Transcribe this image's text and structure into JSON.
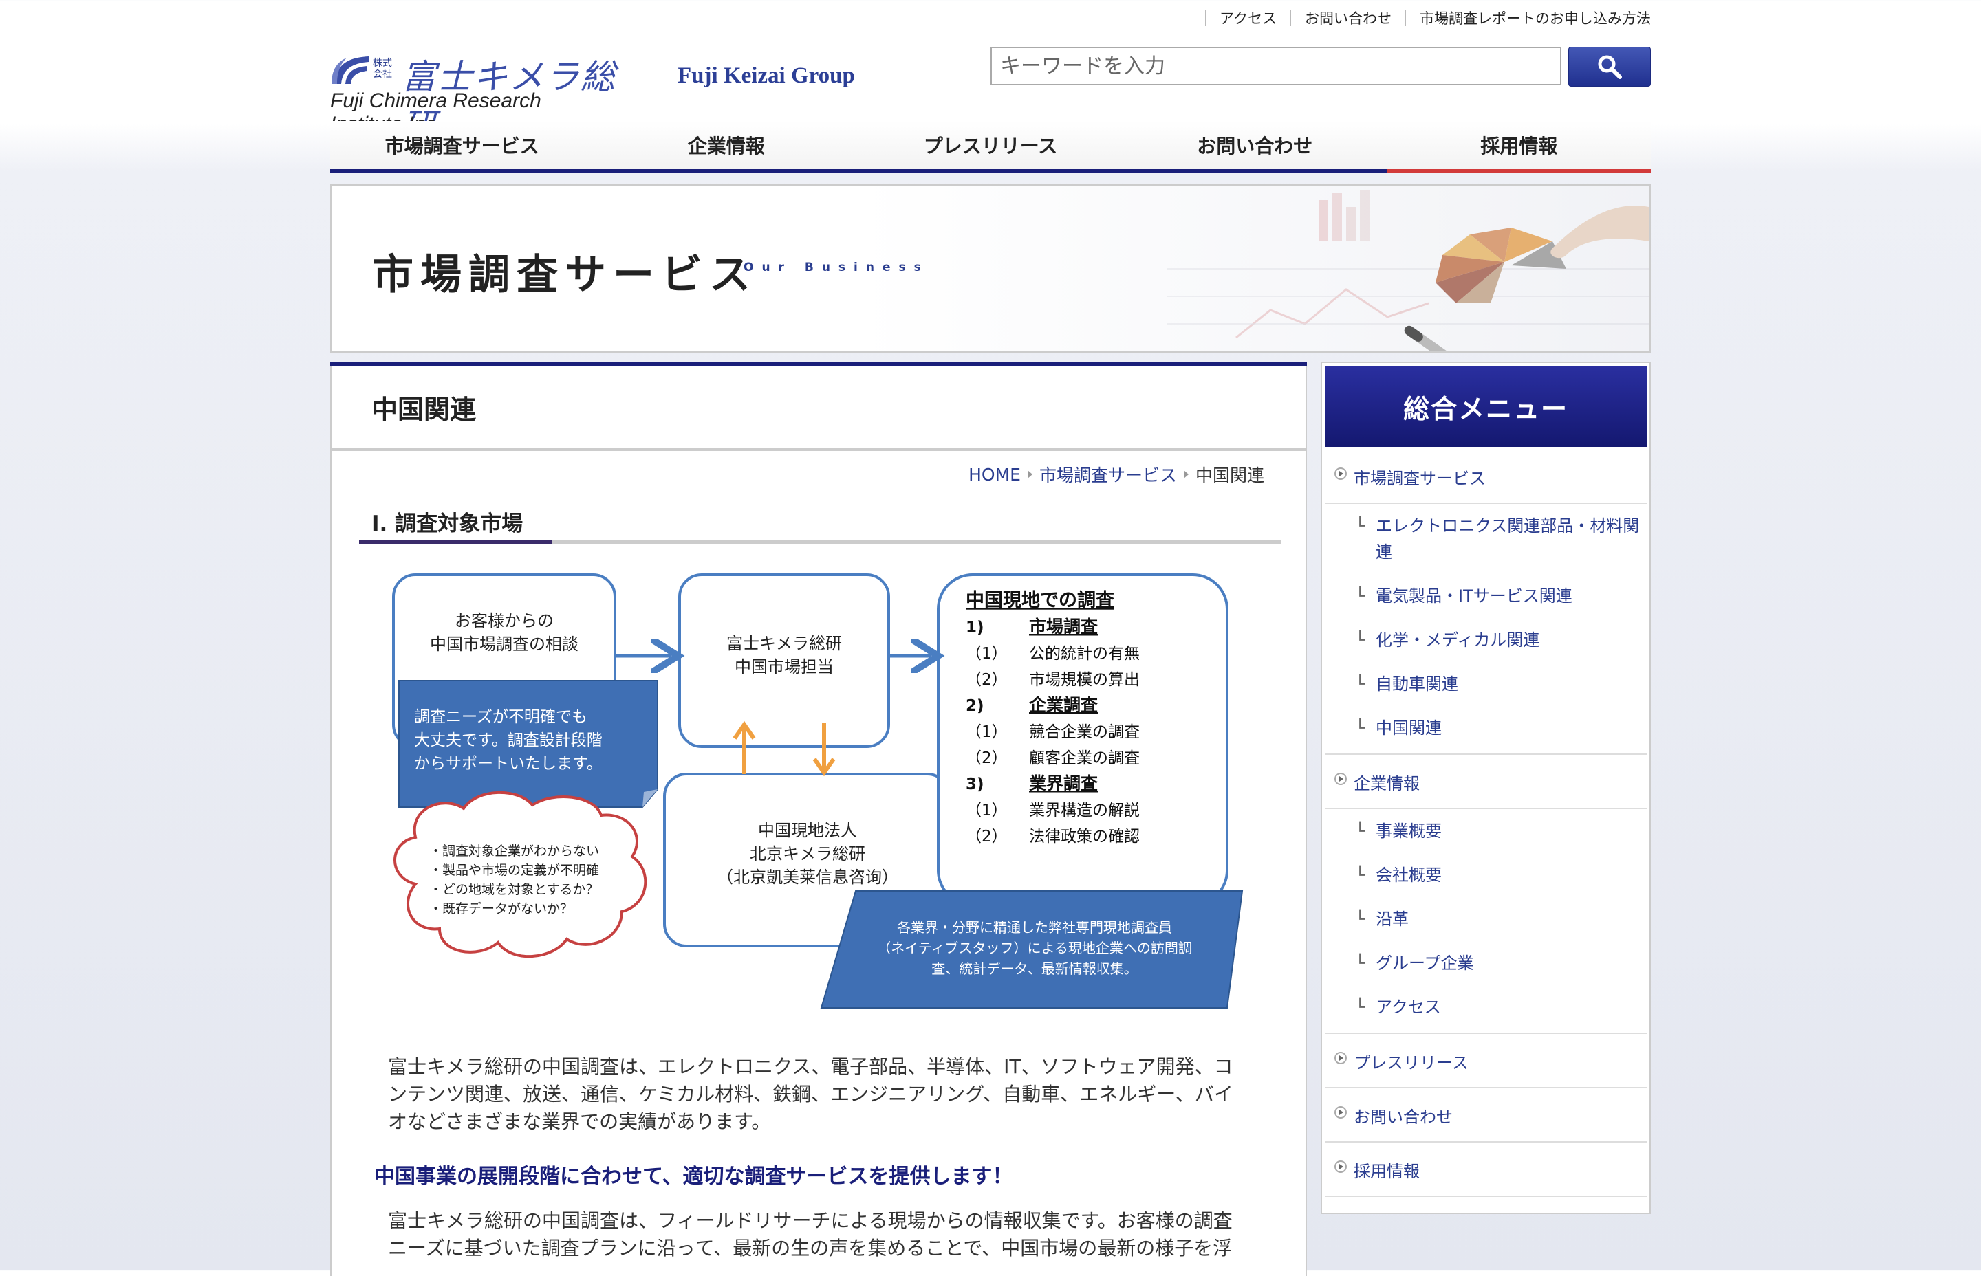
{
  "header": {
    "util_links": [
      "アクセス",
      "お問い合わせ",
      "市場調査レポートのお申し込み方法"
    ],
    "logo": {
      "jp_small_1": "株式",
      "jp_small_2": "会社",
      "jp": "富士キメラ総研",
      "en": "Fuji Chimera Research Institute,Inc"
    },
    "group_name": "Fuji Keizai Group",
    "search": {
      "placeholder": "キーワードを入力",
      "button_icon": "search-icon"
    }
  },
  "nav": {
    "items": [
      "市場調査サービス",
      "企業情報",
      "プレスリリース",
      "お問い合わせ",
      "採用情報"
    ],
    "accent_color": "#1a1f7a",
    "recruit_color": "#d23a3a"
  },
  "banner": {
    "title": "市場調査サービス",
    "subtitle": "Our Business"
  },
  "main": {
    "title": "中国関連",
    "breadcrumb": [
      "HOME",
      "市場調査サービス",
      "中国関連"
    ],
    "section_title": "I.  調査対象市場",
    "diagram": {
      "box1": [
        "お客様からの",
        "中国市場調査の相談"
      ],
      "note1": [
        "調査ニーズが不明確でも",
        "大丈夫です。調査設計段階",
        "からサポートいたします。"
      ],
      "cloud": [
        "・調査対象企業がわからない",
        "・製品や市場の定義が不明確",
        "・どの地域を対象とするか？",
        "・既存データがないか？"
      ],
      "box2": [
        "富士キメラ総研",
        "中国市場担当"
      ],
      "box3": [
        "中国現地法人",
        "北京キメラ総研",
        "（北京凱美莱信息咨询）"
      ],
      "box4_title": "中国現地での調査",
      "box4_lines": [
        {
          "num": "1)",
          "text": "市場調査",
          "bold": true
        },
        {
          "num": "（1）",
          "text": "公的統計の有無",
          "bold": false
        },
        {
          "num": "（2）",
          "text": "市場規模の算出",
          "bold": false
        },
        {
          "num": "2)",
          "text": "企業調査",
          "bold": true
        },
        {
          "num": "（1）",
          "text": "競合企業の調査",
          "bold": false
        },
        {
          "num": "（2）",
          "text": "顧客企業の調査",
          "bold": false
        },
        {
          "num": "3)",
          "text": "業界調査",
          "bold": true
        },
        {
          "num": "（1）",
          "text": "業界構造の解説",
          "bold": false
        },
        {
          "num": "（2）",
          "text": "法律政策の確認",
          "bold": false
        }
      ],
      "note2": [
        "各業界・分野に精通した弊社専門現地調査員",
        "（ネイティブスタッフ）による現地企業への訪問調",
        "査、統計データ、最新情報収集。"
      ]
    },
    "para1": [
      "富士キメラ総研の中国調査は、エレクトロニクス、電子部品、半導体、IT、ソフトウェア開発、コ",
      "ンテンツ関連、放送、通信、ケミカル材料、鉄鋼、エンジニアリング、自動車、エネルギー、バイ",
      "オなどさまざまな業界での実績があります。"
    ],
    "lead": "中国事業の展開段階に合わせて、適切な調査サービスを提供します！",
    "para2": [
      "富士キメラ総研の中国調査は、フィールドリサーチによる現場からの情報収集です。お客様の調査",
      "ニーズに基づいた調査プランに沿って、最新の生の声を集めることで、中国市場の最新の様子を浮"
    ]
  },
  "sidebar": {
    "title": "総合メニュー",
    "top1": "市場調査サービス",
    "subs1": [
      "エレクトロニクス関連部品・材料関連",
      "電気製品・ITサービス関連",
      "化学・メディカル関連",
      "自動車関連",
      "中国関連"
    ],
    "top2": "企業情報",
    "subs2": [
      "事業概要",
      "会社概要",
      "沿革",
      "グループ企業",
      "アクセス"
    ],
    "top3": "プレスリリース",
    "top4": "お問い合わせ",
    "top5": "採用情報"
  }
}
